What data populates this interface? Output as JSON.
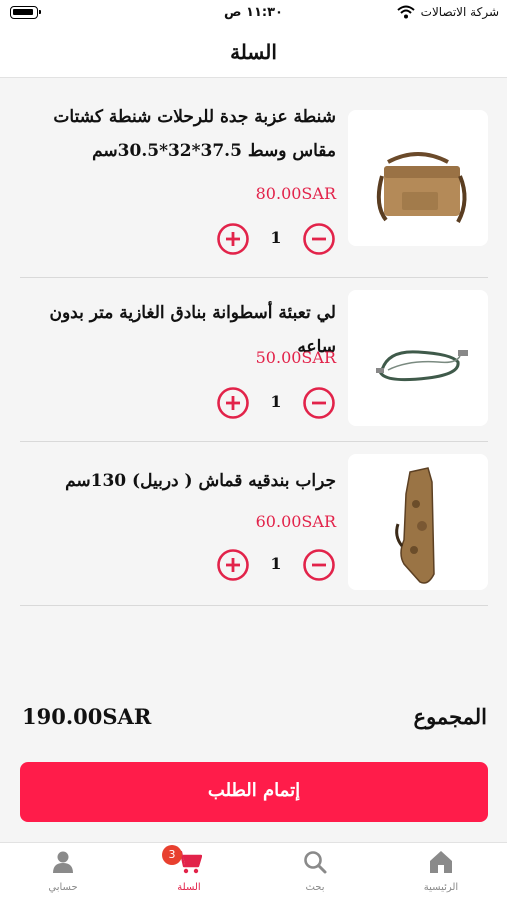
{
  "status_bar": {
    "time": "١١:٣٠ ص",
    "carrier": "شركة الاتصالات"
  },
  "header": {
    "title": "السلة"
  },
  "cart": {
    "items": [
      {
        "name_line1": "شنطة عزبة جدة للرحلات شنطة كشتات",
        "name_line2": "مقاس وسط 37.5*32*30.5سم",
        "price": "80.00SAR",
        "quantity": "1"
      },
      {
        "name_line1": "لي تعبئة أسطوانة بنادق الغازية متر بدون ساعه",
        "price": "50.00SAR",
        "quantity": "1"
      },
      {
        "name_line1": "جراب  بندقيه قماش ( دربيل) 130سم",
        "price": "60.00SAR",
        "quantity": "1"
      }
    ]
  },
  "summary": {
    "total_label": "المجموع",
    "total_value": "190.00SAR"
  },
  "checkout": {
    "label": "إتمام الطلب"
  },
  "tab_bar": {
    "tabs": [
      {
        "label": "حسابي",
        "icon": "person-icon"
      },
      {
        "label": "السلة",
        "icon": "cart-icon",
        "badge": "3"
      },
      {
        "label": "بحث",
        "icon": "search-icon"
      },
      {
        "label": "الرئيسية",
        "icon": "home-icon"
      }
    ]
  },
  "colors": {
    "accent": "#ff1c4a",
    "price": "#e2234a",
    "tab_inactive": "#8a8a8a"
  }
}
